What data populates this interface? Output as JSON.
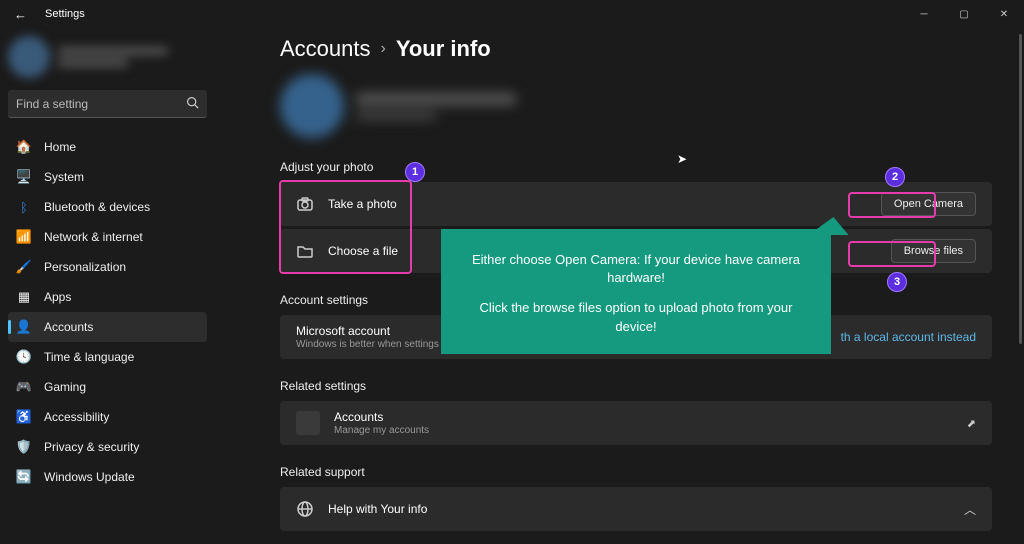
{
  "window": {
    "title": "Settings"
  },
  "search": {
    "placeholder": "Find a setting"
  },
  "nav": {
    "home": "Home",
    "system": "System",
    "bluetooth": "Bluetooth & devices",
    "network": "Network & internet",
    "personalization": "Personalization",
    "apps": "Apps",
    "accounts": "Accounts",
    "time": "Time & language",
    "gaming": "Gaming",
    "accessibility": "Accessibility",
    "privacy": "Privacy & security",
    "update": "Windows Update"
  },
  "breadcrumb": {
    "parent": "Accounts",
    "current": "Your info"
  },
  "sections": {
    "adjust": "Adjust your photo",
    "account": "Account settings",
    "related": "Related settings",
    "support": "Related support"
  },
  "rows": {
    "takePhoto": "Take a photo",
    "openCamera": "Open Camera",
    "chooseFile": "Choose a file",
    "browseFiles": "Browse files",
    "msAccount": "Microsoft account",
    "msAccountSub": "Windows is better when settings and files",
    "localLink": "th a local account instead",
    "accounts": "Accounts",
    "accountsSub": "Manage my accounts",
    "help": "Help with Your info"
  },
  "badges": {
    "b1": "1",
    "b2": "2",
    "b3": "3"
  },
  "tooltip": {
    "line1": "Either choose Open Camera: If your device have camera hardware!",
    "line2": "Click the browse files option to upload photo from your device!"
  }
}
